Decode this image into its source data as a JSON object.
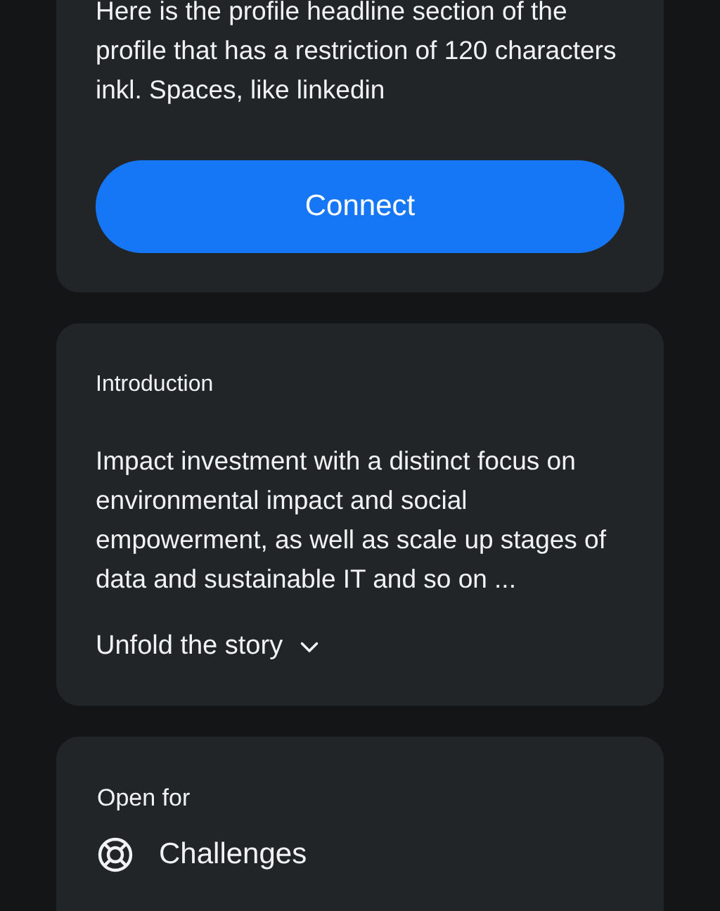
{
  "headline_card": {
    "headline": "Here is the profile headline section of the profile that has a restriction of 120 characters inkl. Spaces, like linkedin",
    "button": "Connect"
  },
  "introduction": {
    "title": "Introduction",
    "text": "Impact investment with a distinct focus on environmental impact and social empowerment, as well as scale up stages of data and sustainable IT and so on ...",
    "toggle": "Unfold the story",
    "expanded": false
  },
  "open_for": {
    "title": "Open for",
    "items": [
      {
        "label": "Challenges"
      }
    ]
  }
}
